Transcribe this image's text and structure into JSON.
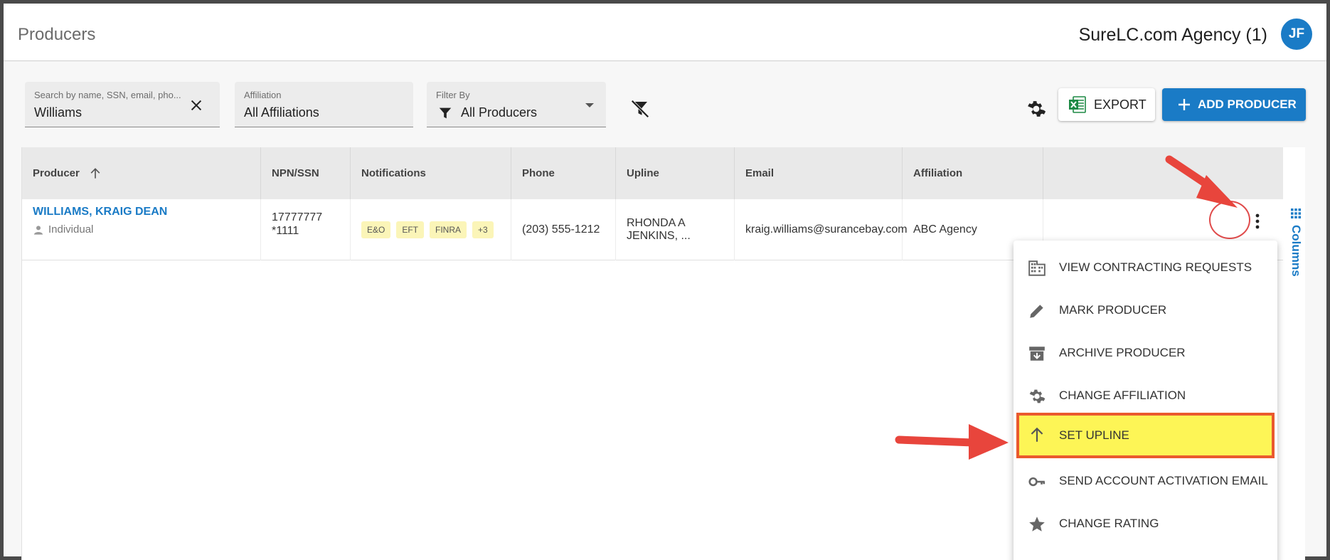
{
  "header": {
    "title": "Producers",
    "agency": "SureLC.com Agency (1)",
    "avatar_initials": "JF"
  },
  "filters": {
    "search": {
      "label": "Search by name, SSN, email, pho...",
      "value": "Williams"
    },
    "affiliation": {
      "label": "Affiliation",
      "value": "All Affiliations"
    },
    "filter_by": {
      "label": "Filter By",
      "value": "All Producers"
    }
  },
  "toolbar": {
    "export_label": "EXPORT",
    "add_label": "ADD PRODUCER"
  },
  "table": {
    "columns": [
      "Producer",
      "NPN/SSN",
      "Notifications",
      "Phone",
      "Upline",
      "Email",
      "Affiliation"
    ],
    "rows": [
      {
        "producer": "WILLIAMS, KRAIG DEAN",
        "type": "Individual",
        "npn": "17777777",
        "ssn": "*1111",
        "notifications": [
          "E&O",
          "EFT",
          "FINRA",
          "+3"
        ],
        "phone": "(203) 555-1212",
        "upline": "RHONDA A JENKINS, ...",
        "email": "kraig.williams@surancebay.com",
        "affiliation": "ABC Agency"
      }
    ]
  },
  "columns_panel_label": "Columns",
  "menu": {
    "items": [
      {
        "label": "VIEW CONTRACTING REQUESTS",
        "icon": "building-icon"
      },
      {
        "label": "MARK PRODUCER",
        "icon": "pencil-icon"
      },
      {
        "label": "ARCHIVE PRODUCER",
        "icon": "archive-icon"
      },
      {
        "label": "CHANGE AFFILIATION",
        "icon": "gear-icon"
      },
      {
        "label": "SET UPLINE",
        "icon": "arrow-up-icon",
        "highlighted": true
      },
      {
        "label": "SEND ACCOUNT ACTIVATION EMAIL",
        "icon": "key-icon"
      },
      {
        "label": "CHANGE RATING",
        "icon": "star-icon"
      }
    ]
  },
  "colors": {
    "brand_blue": "#1a7bc6",
    "highlight": "#fdf556",
    "annotation_red": "#e8453c",
    "badge_bg": "#fbf5b8"
  }
}
